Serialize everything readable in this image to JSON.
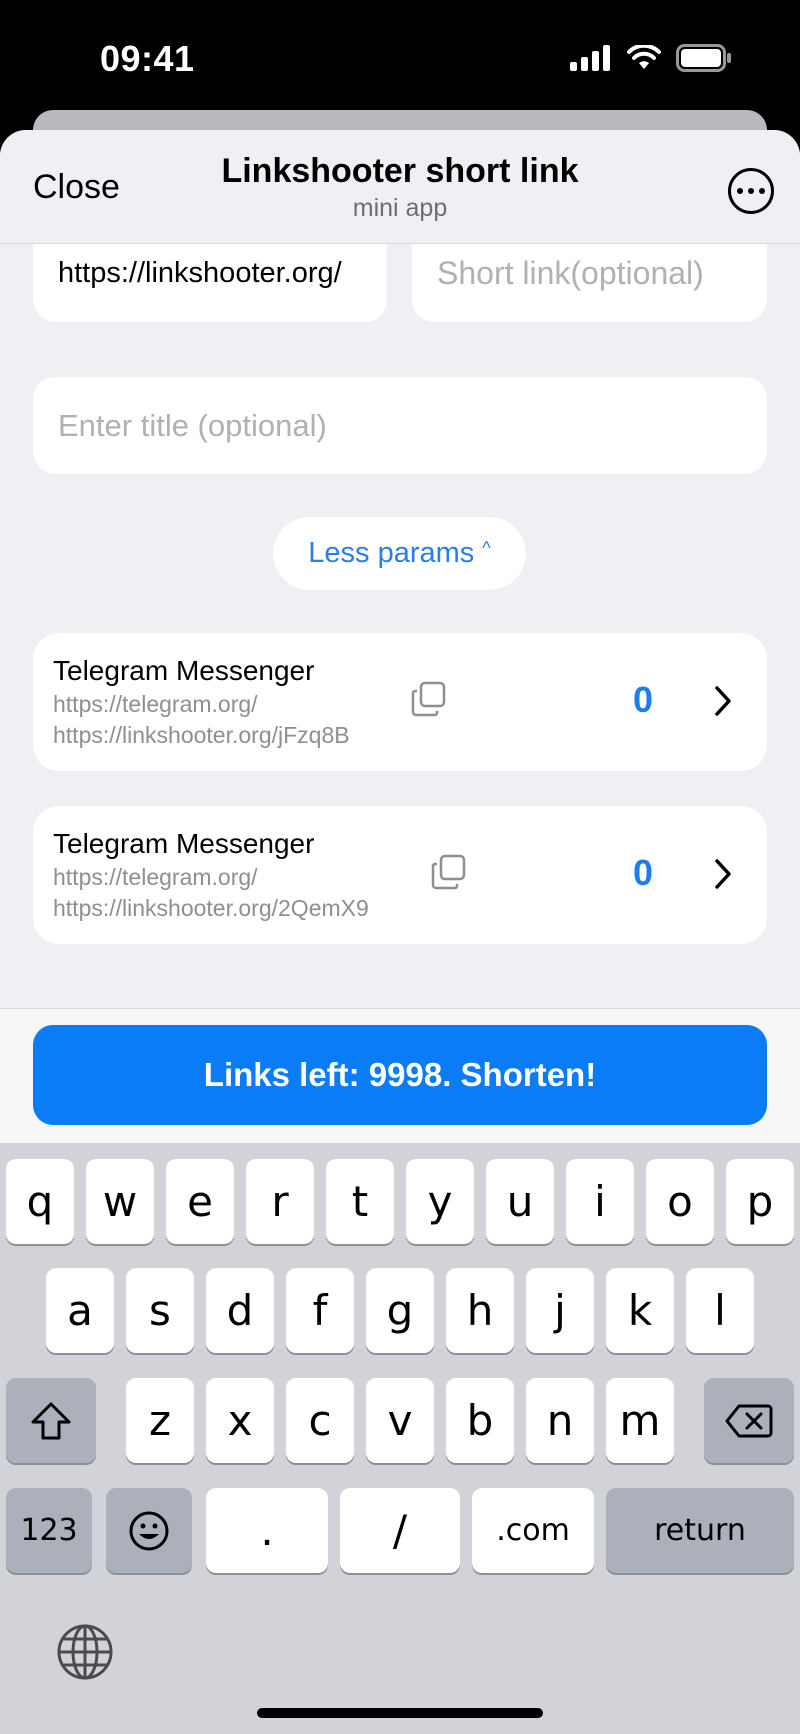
{
  "status_bar": {
    "time": "09:41"
  },
  "header": {
    "close_label": "Close",
    "title": "Linkshooter short link",
    "subtitle": "mini app"
  },
  "form": {
    "url_value": "https://linkshooter.org/",
    "short_link_placeholder": "Short link(optional)",
    "title_placeholder": "Enter title (optional)",
    "less_params_label": "Less params",
    "less_params_caret": "^"
  },
  "links": [
    {
      "title": "Telegram Messenger",
      "url": "https://telegram.org/",
      "short_url": "https://linkshooter.org/jFzq8B",
      "count": "0"
    },
    {
      "title": "Telegram Messenger",
      "url": "https://telegram.org/",
      "short_url": "https://linkshooter.org/2QemX9",
      "count": "0"
    }
  ],
  "action": {
    "shorten_label": "Links left: 9998. Shorten!"
  },
  "keyboard": {
    "row1": [
      "q",
      "w",
      "e",
      "r",
      "t",
      "y",
      "u",
      "i",
      "o",
      "p"
    ],
    "row2": [
      "a",
      "s",
      "d",
      "f",
      "g",
      "h",
      "j",
      "k",
      "l"
    ],
    "row3": [
      "z",
      "x",
      "c",
      "v",
      "b",
      "n",
      "m"
    ],
    "numbers_label": "123",
    "dot_label": ".",
    "slash_label": "/",
    "dotcom_label": ".com",
    "return_label": "return"
  },
  "colors": {
    "accent": "#0a7cf5",
    "link_text": "#2a7ee6",
    "background": "#efeff4"
  }
}
